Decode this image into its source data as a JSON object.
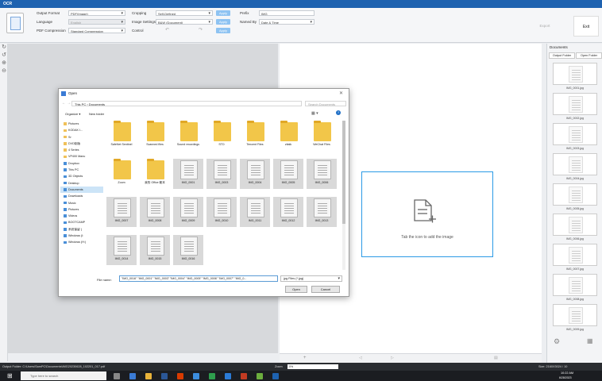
{
  "app": {
    "title": "OCR"
  },
  "toolbar": {
    "output_format_label": "Output Format",
    "output_format_value": "PDF(Image)",
    "language_label": "Language",
    "language_value": "English",
    "compression_label": "PDF Compression",
    "compression_value": "Standard Compression",
    "cropping_label": "Cropping",
    "cropping_value": "Self-Defined",
    "image_settings_label": "Image Settings",
    "image_settings_value": "B&W (Document)",
    "control_label": "Control",
    "prefix_label": "Prefix",
    "prefix_value": "IMG_",
    "named_by_label": "Named By",
    "named_by_value": "Date & Time",
    "small_btn": "Apply",
    "export_label": "Export",
    "exit_label": "Exit"
  },
  "left_tools": [
    "↻",
    "↺",
    "⊕",
    "⊖"
  ],
  "canvas": {
    "add_hint": "Tab the icon to add the image"
  },
  "right_panel": {
    "header": "Documents",
    "tab_output": "Output Folder",
    "tab_open": "Open Folder",
    "thumbs": [
      "IMG_0001.jpg",
      "IMG_0002.jpg",
      "IMG_0003.jpg",
      "IMG_0004.jpg",
      "IMG_0005.jpg",
      "IMG_0006.jpg",
      "IMG_0007.jpg",
      "IMG_0008.jpg",
      "IMG_0009.jpg"
    ]
  },
  "status": {
    "output_folder": "Output Folder: C:\\Users\\SamPC\\Documents\\IMG20230628_102201_017.pdf",
    "zoom_label": "Zoom",
    "zoom_value": "0%",
    "size": "Size: 2160X3024 / 10"
  },
  "taskbar": {
    "search": "Type here to search",
    "time": "10:22 AM",
    "date": "6/28/2023"
  },
  "dialog": {
    "title": "Open",
    "breadcrumb": "This PC  ›  Documents",
    "search_placeholder": "Search Documents",
    "organize": "Organize ▾",
    "new_folder": "New folder",
    "nav": [
      "Pictures",
      "KODAK I...",
      "Sr",
      "DVD制版",
      "4 Series",
      "VP400 Manu",
      "Dropbox",
      "This PC",
      "3D Objects",
      "Desktop",
      "Documents",
      "Downloads",
      "Music",
      "Pictures",
      "Videos",
      "BOOTCAMP",
      "系统保留 (",
      "Windows (I:",
      "Windows (H:)"
    ],
    "folders": [
      "SafeNet Sentinel",
      "Scanned files",
      "Sound recordings",
      "STD",
      "Tencent Files",
      "zitalk",
      "WeChat Files",
      "Zoom",
      "我的 Office 範本"
    ],
    "files": [
      "IMG_0001",
      "IMG_0003",
      "IMG_0004",
      "IMG_0005",
      "IMG_0006",
      "IMG_0007",
      "IMG_0008",
      "IMG_0009",
      "IMG_0010",
      "IMG_0011",
      "IMG_0012",
      "IMG_0013",
      "IMG_0014",
      "IMG_0015",
      "IMG_0016"
    ],
    "file_name_label": "File name:",
    "file_name_value": "\"IMG_0016\" \"IMG_0001\" \"IMG_0003\" \"IMG_0004\" \"IMG_0005\" \"IMG_0006\" \"IMG_0007\" \"IMG_0...",
    "file_type": "jpg Files (*.jpg)",
    "open_btn": "Open",
    "cancel_btn": "Cancel"
  }
}
